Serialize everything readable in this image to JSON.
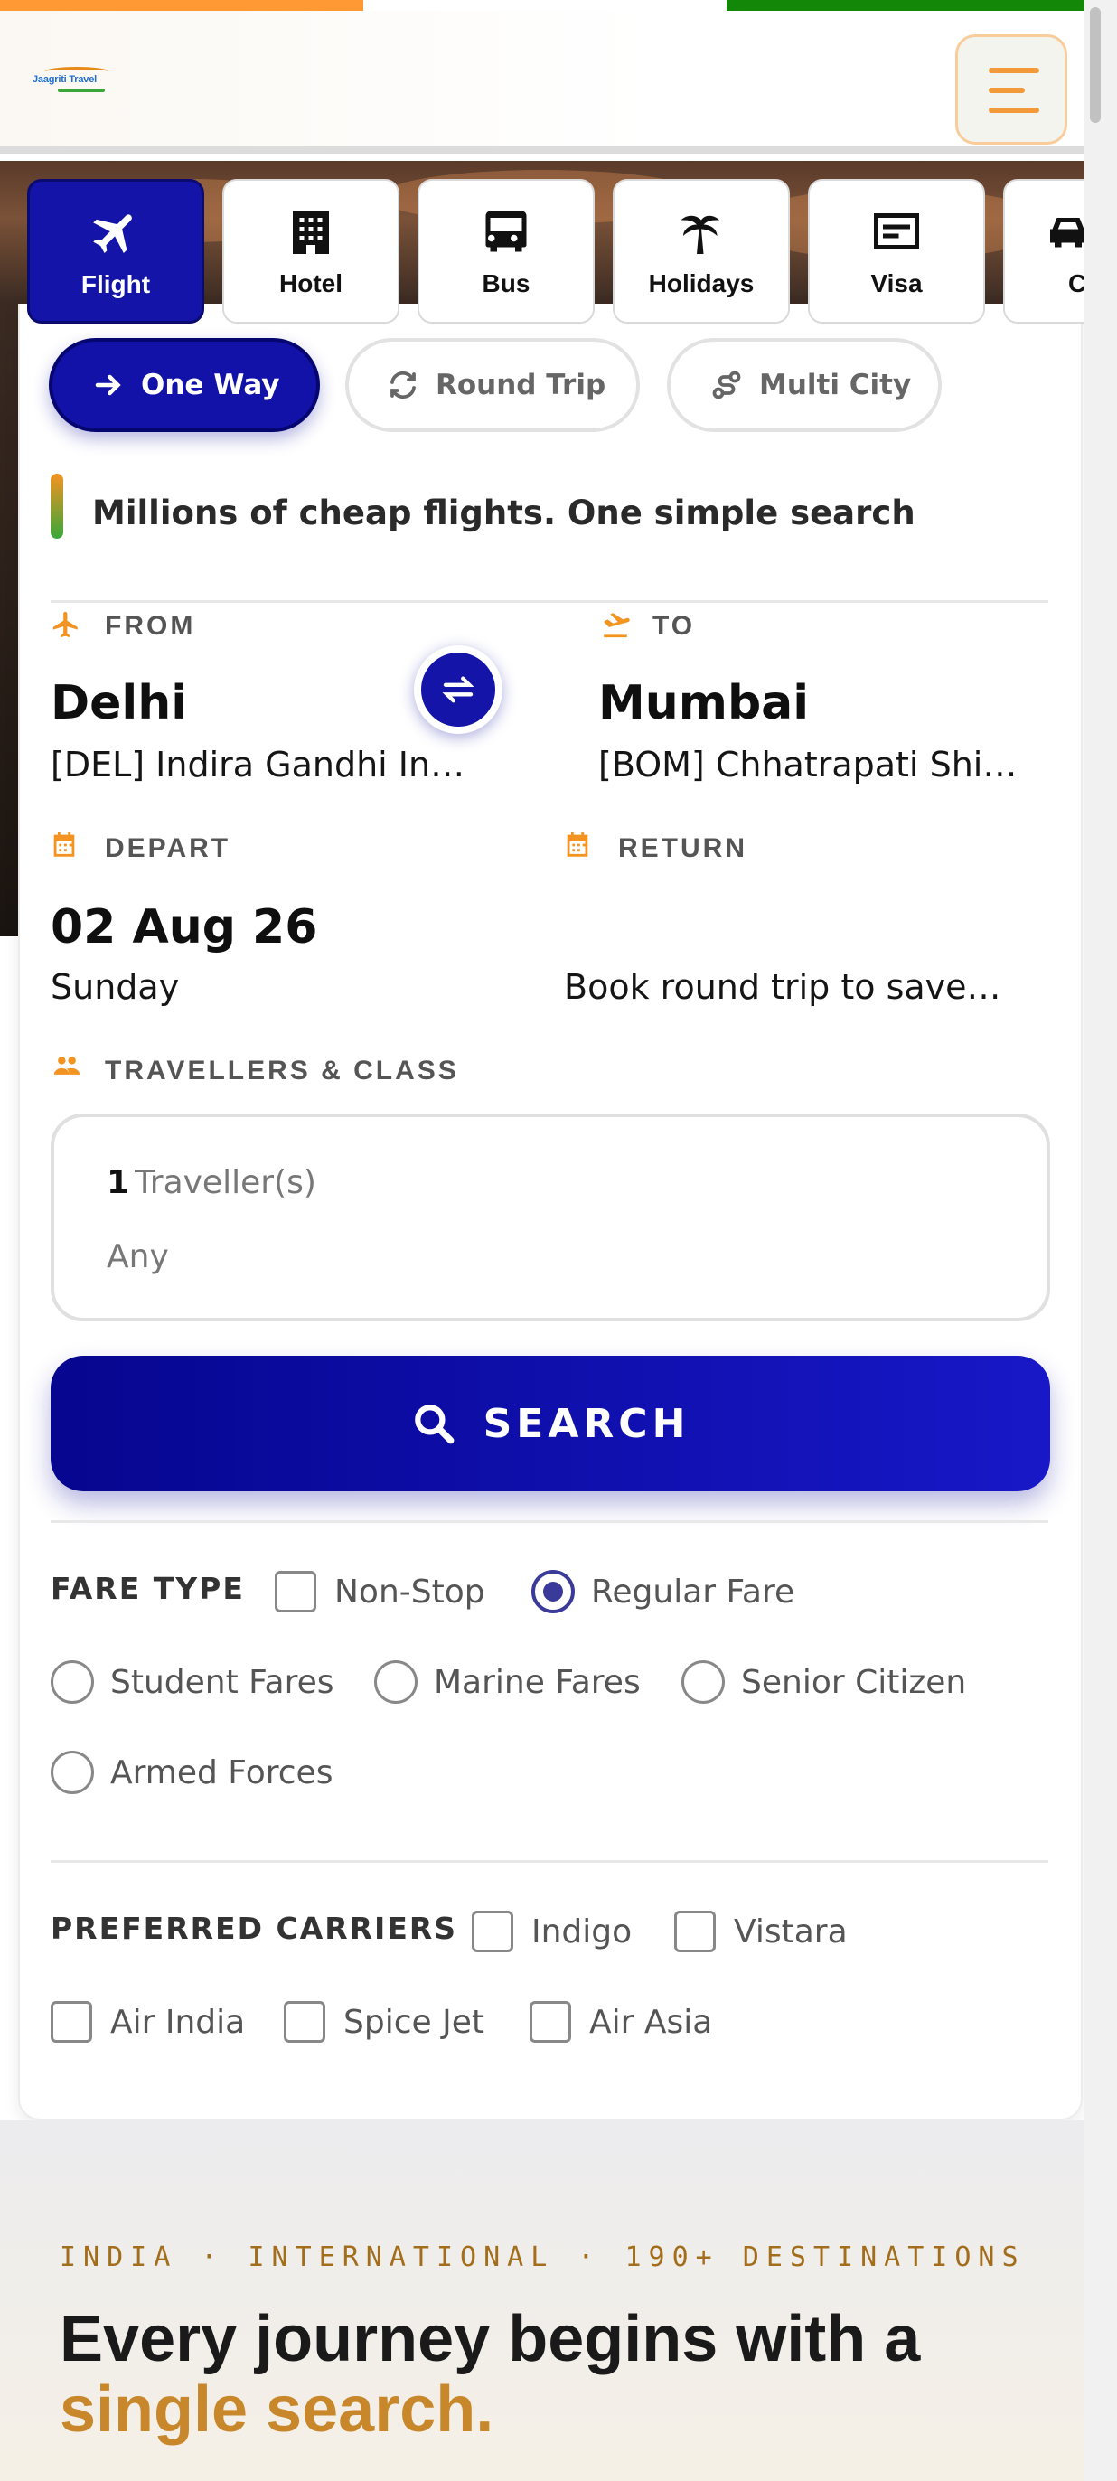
{
  "header": {
    "logo_text": "Jaagriti Travel"
  },
  "services": [
    {
      "label": "Flight",
      "icon": "airplane-icon",
      "active": true
    },
    {
      "label": "Hotel",
      "icon": "building-icon",
      "active": false
    },
    {
      "label": "Bus",
      "icon": "bus-icon",
      "active": false
    },
    {
      "label": "Holidays",
      "icon": "palm-tree-icon",
      "active": false
    },
    {
      "label": "Visa",
      "icon": "id-card-icon",
      "active": false
    },
    {
      "label": "C",
      "icon": "car-icon",
      "active": false
    }
  ],
  "trip_types": [
    {
      "label": "One Way",
      "icon": "arrow-right-icon",
      "active": true
    },
    {
      "label": "Round Trip",
      "icon": "refresh-icon",
      "active": false
    },
    {
      "label": "Multi City",
      "icon": "route-icon",
      "active": false
    }
  ],
  "tagline": "Millions of cheap flights. One simple search",
  "from": {
    "label": "FROM",
    "city": "Delhi",
    "airport": "[DEL] Indira Gandhi International Airport"
  },
  "to": {
    "label": "TO",
    "city": "Mumbai",
    "airport": "[BOM] Chhatrapati Shivaji Maharaj International Airport"
  },
  "depart": {
    "label": "DEPART",
    "date": "02 Aug 26",
    "day": "Sunday"
  },
  "return": {
    "label": "RETURN",
    "hint": "Book round trip to save extra"
  },
  "travellers": {
    "label": "TRAVELLERS & CLASS",
    "count": "1",
    "count_suffix": "Traveller(s)",
    "class": "Any"
  },
  "search_label": "SEARCH",
  "fare_type": {
    "label": "FARE TYPE",
    "options": [
      {
        "label": "Non-Stop",
        "kind": "checkbox",
        "checked": false
      },
      {
        "label": "Regular Fare",
        "kind": "radio",
        "checked": true
      },
      {
        "label": "Student Fares",
        "kind": "radio",
        "checked": false
      },
      {
        "label": "Marine Fares",
        "kind": "radio",
        "checked": false
      },
      {
        "label": "Senior Citizen",
        "kind": "radio",
        "checked": false
      },
      {
        "label": "Armed Forces",
        "kind": "radio",
        "checked": false
      }
    ]
  },
  "preferred_carriers": {
    "label": "PREFERRED CARRIERS",
    "options": [
      {
        "label": "Indigo",
        "checked": false
      },
      {
        "label": "Vistara",
        "checked": false
      },
      {
        "label": "Air India",
        "checked": false
      },
      {
        "label": "Spice Jet",
        "checked": false
      },
      {
        "label": "Air Asia",
        "checked": false
      }
    ]
  },
  "promo": {
    "kicker": "INDIA · INTERNATIONAL · 190+ DESTINATIONS",
    "headline": "Every journey begins with a",
    "headline_accent": "single search."
  },
  "colors": {
    "brand_blue": "#1414a8",
    "accent_orange": "#f39321",
    "accent_gold": "#c8872a",
    "flag_orange": "#ff9933",
    "flag_green": "#138808"
  }
}
